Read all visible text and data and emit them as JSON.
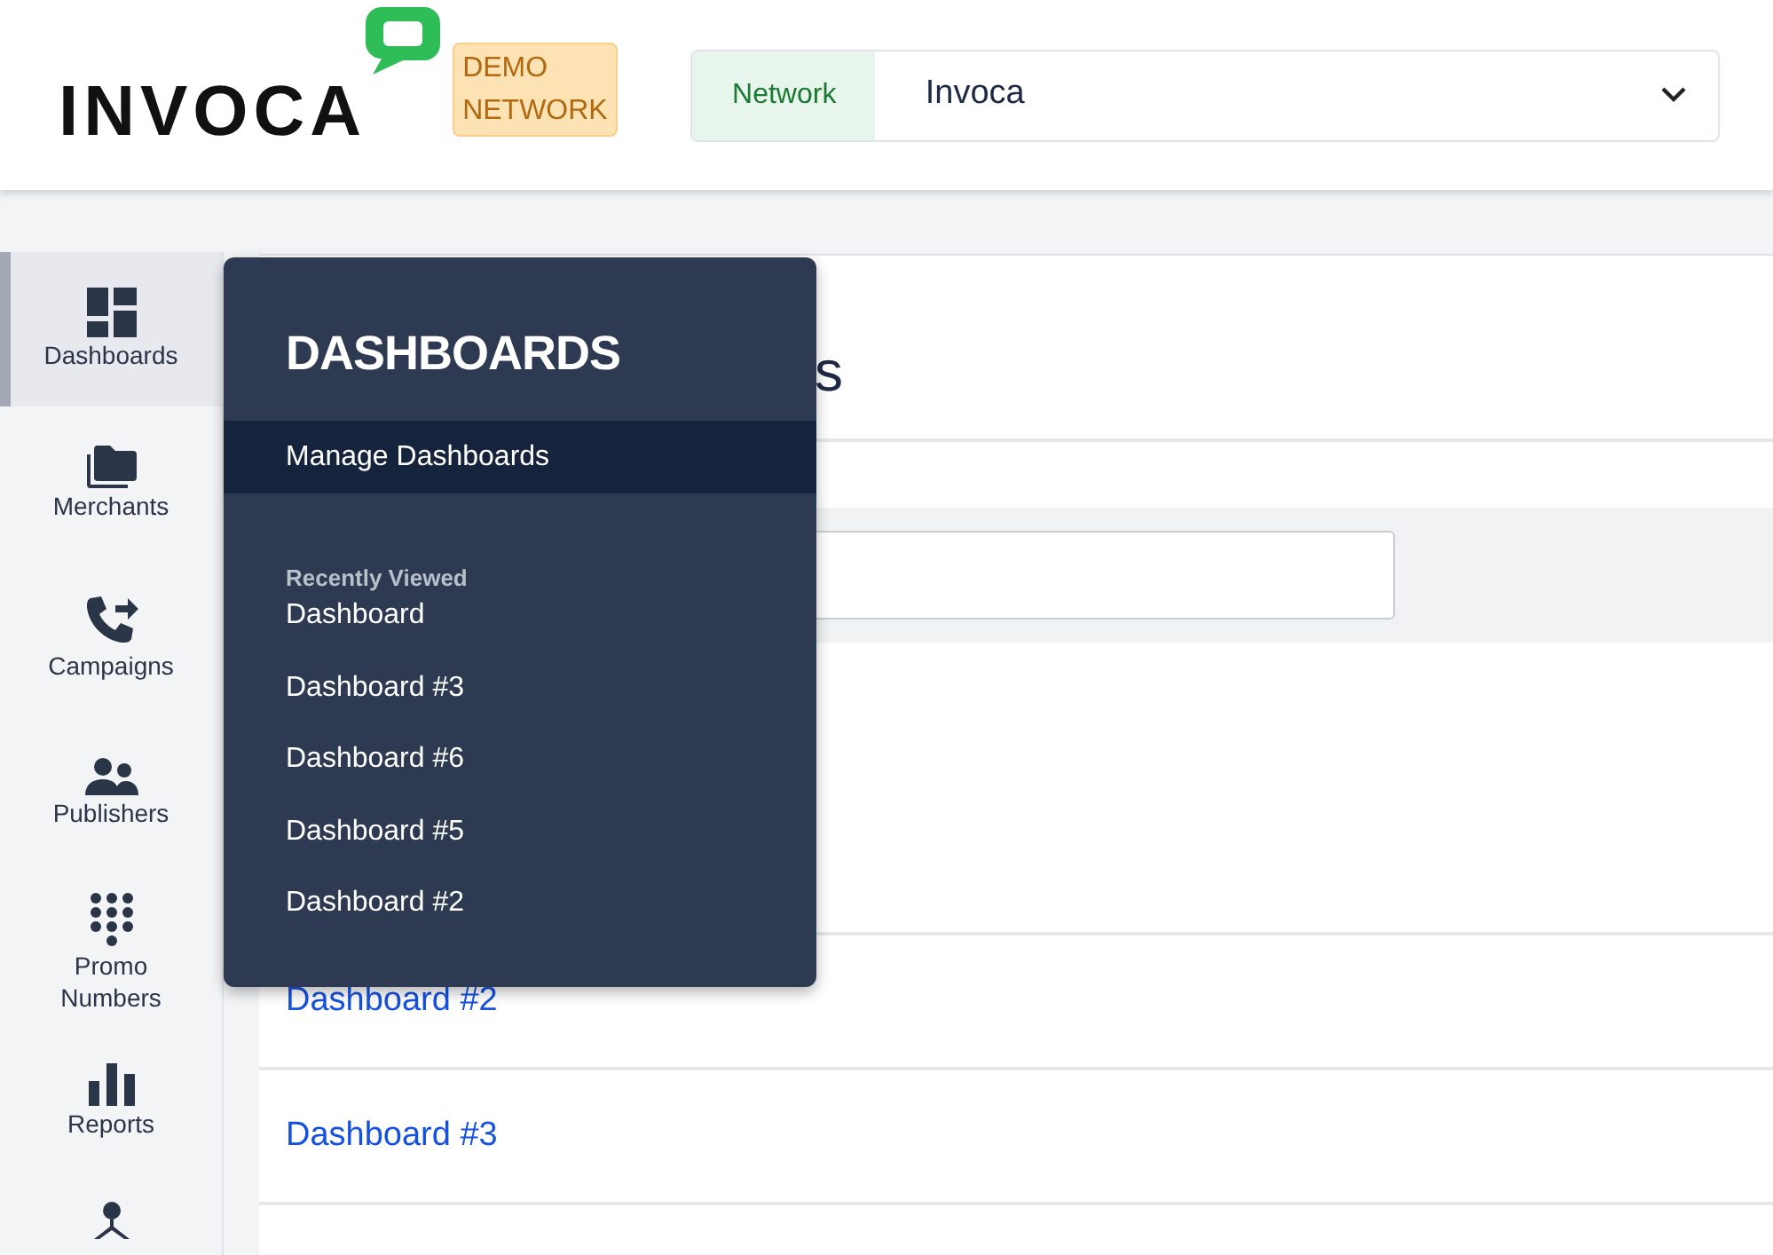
{
  "header": {
    "logo": "INVOCA",
    "badge": [
      "DEMO",
      "NETWORK"
    ],
    "network_select": {
      "label": "Network",
      "value": "Invoca"
    }
  },
  "sidebar": {
    "items": [
      {
        "kind": "dashboard",
        "label": "Dashboards",
        "selected": true
      },
      {
        "kind": "folders",
        "label": "Merchants",
        "selected": false
      },
      {
        "kind": "phone",
        "label": "Campaigns",
        "selected": false
      },
      {
        "kind": "people",
        "label": "Publishers",
        "selected": false
      },
      {
        "kind": "dialpad",
        "label": "Promo Numbers",
        "selected": false
      },
      {
        "kind": "bars",
        "label": "Reports",
        "selected": false
      },
      {
        "kind": "hierarchy",
        "selected": false
      }
    ]
  },
  "flyout": {
    "title": "DASHBOARDS",
    "items": [
      {
        "label": "Manage Dashboards",
        "selected": true
      }
    ],
    "section": "Recently Viewed",
    "recent": [
      "Dashboard",
      "Dashboard #3",
      "Dashboard #6",
      "Dashboard #5",
      "Dashboard #2"
    ]
  },
  "page": {
    "heading": "s",
    "rows": [
      "Dashboard #2",
      "Dashboard #3"
    ]
  }
}
